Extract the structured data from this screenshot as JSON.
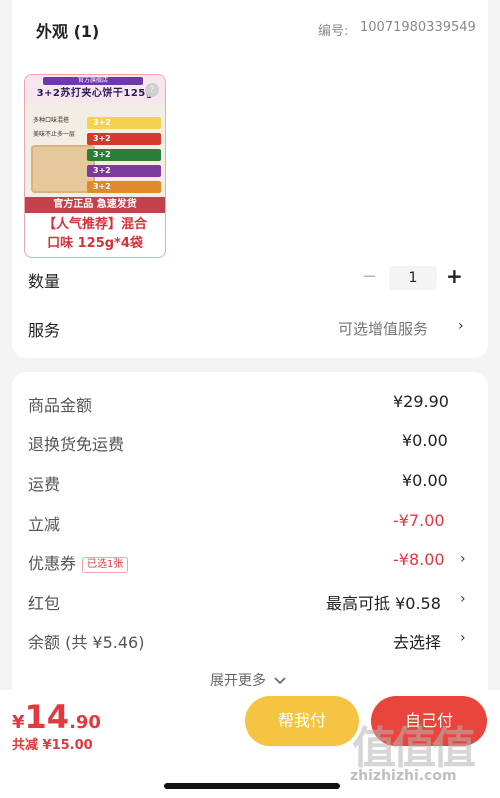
{
  "section": {
    "appearance_label": "外观 (1)",
    "order_no_label": "编号:",
    "order_no_value": "10071980339549"
  },
  "product": {
    "badge_text": "官方旗舰店",
    "thumb_title": "3+2苏打夹心饼干125g",
    "thumb_text1": "多种口味混搭",
    "thumb_text2": "美味不止多一层",
    "thumb_band": "官方正品  急速发货",
    "caption_line1": "【人气推荐】混合",
    "caption_line2": "口味 125g*4袋"
  },
  "quantity": {
    "label": "数量",
    "minus": "−",
    "value": "1",
    "plus": "+"
  },
  "service": {
    "label": "服务",
    "value": "可选增值服务",
    "chevron": "›"
  },
  "price_rows": [
    {
      "label": "商品金额",
      "value": "¥29.90"
    },
    {
      "label": "退换货免运费",
      "value": "¥0.00"
    },
    {
      "label": "运费",
      "value": "¥0.00"
    },
    {
      "label": "立减",
      "value": "-¥7.00"
    },
    {
      "label": "优惠券",
      "tag": "已选1张",
      "value": "-¥8.00",
      "chevron": "›"
    },
    {
      "label": "红包",
      "value": "最高可抵 ¥0.58",
      "chevron": "›"
    },
    {
      "label": "余额 (共 ¥5.46)",
      "value": "去选择",
      "chevron": "›"
    }
  ],
  "expand": {
    "label": "展开更多",
    "icon": "chevron-down-icon"
  },
  "bottom": {
    "currency": "¥",
    "price_int": "14",
    "price_dec": ".90",
    "saving": "共减 ¥15.00",
    "help_pay_label": "帮我付",
    "self_pay_label": "自己付"
  },
  "watermark": {
    "logo": "值值值",
    "url": "zhizhizhi.com"
  },
  "colors": {
    "accent_red": "#e0393e",
    "help_yellow": "#f6c441",
    "pay_red": "#e8453c",
    "background": "#f4f4f4"
  }
}
